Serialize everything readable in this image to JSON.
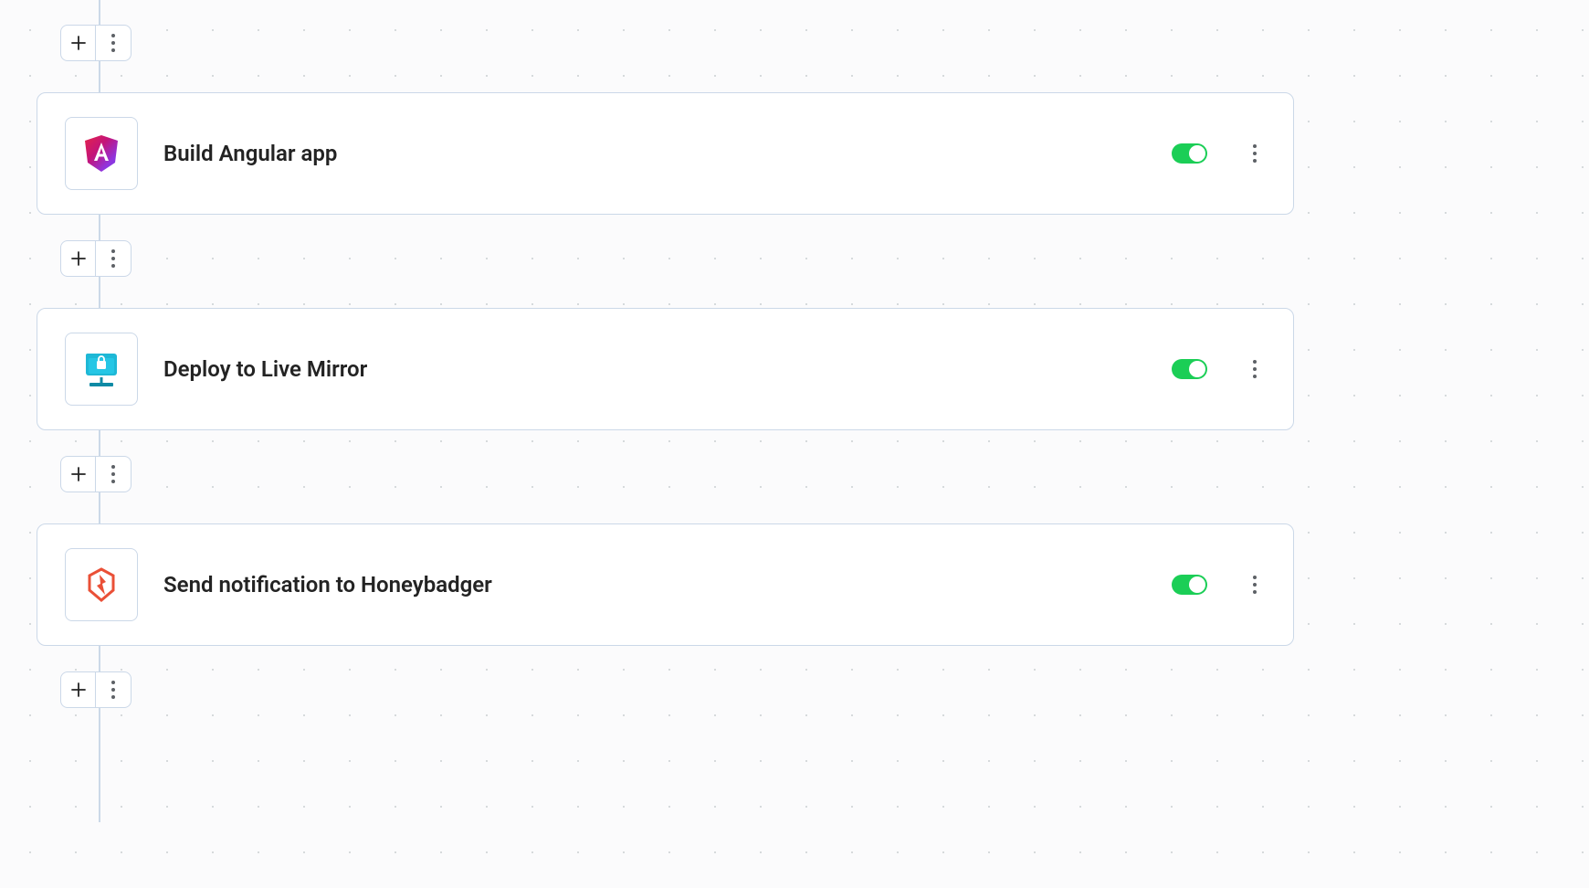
{
  "steps": [
    {
      "title": "Build Angular app",
      "icon": "angular",
      "enabled": true
    },
    {
      "title": "Deploy to Live Mirror",
      "icon": "sftp-secure",
      "enabled": true
    },
    {
      "title": "Send notification to Honeybadger",
      "icon": "honeybadger",
      "enabled": true
    }
  ],
  "colors": {
    "toggle_on": "#1BCE56",
    "border": "#CBD8E8"
  }
}
